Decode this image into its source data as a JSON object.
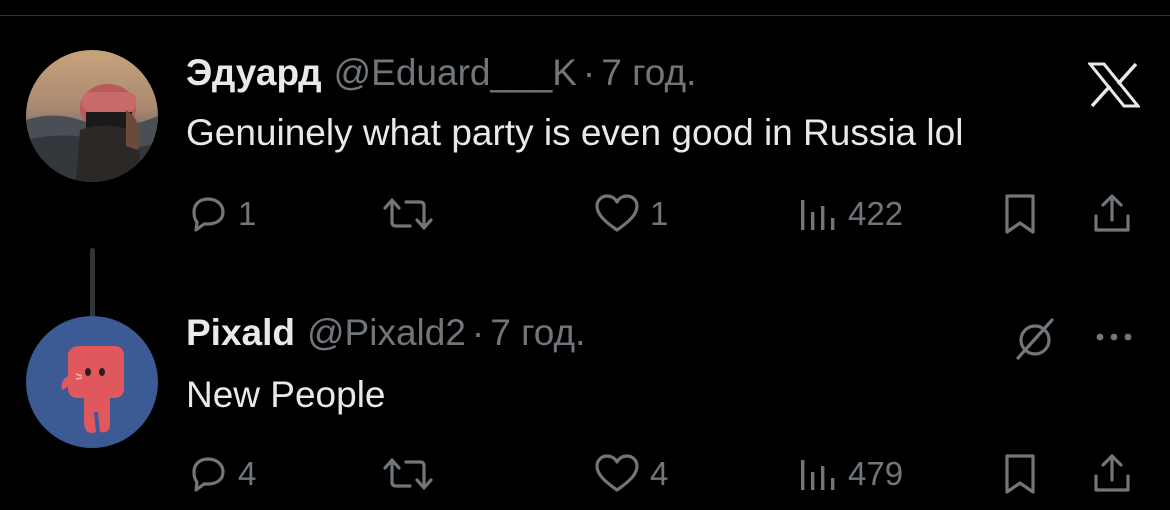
{
  "tweets": [
    {
      "author": {
        "display_name": "Эдуард",
        "handle": "@Eduard___K",
        "avatar": "profile-photo-avatar"
      },
      "separator": "·",
      "time": "7 год.",
      "text": "Genuinely what party is even good in Russia lol",
      "top_right_icon": "x-logo-icon",
      "stats": {
        "replies": "1",
        "retweets": "",
        "likes": "1",
        "views": "422"
      }
    },
    {
      "author": {
        "display_name": "Pixald",
        "handle": "@Pixald2",
        "avatar": "cartoon-creature-avatar"
      },
      "separator": "·",
      "time": "7 год.",
      "text": "New People",
      "top_right_icons": [
        "grok-icon",
        "more-icon"
      ],
      "stats": {
        "replies": "4",
        "retweets": "",
        "likes": "4",
        "views": "479"
      }
    }
  ],
  "colors": {
    "background": "#000000",
    "primary_text": "#e7e9ea",
    "secondary_text": "#71767b",
    "divider": "#2f3336",
    "thread_line": "#333639"
  }
}
